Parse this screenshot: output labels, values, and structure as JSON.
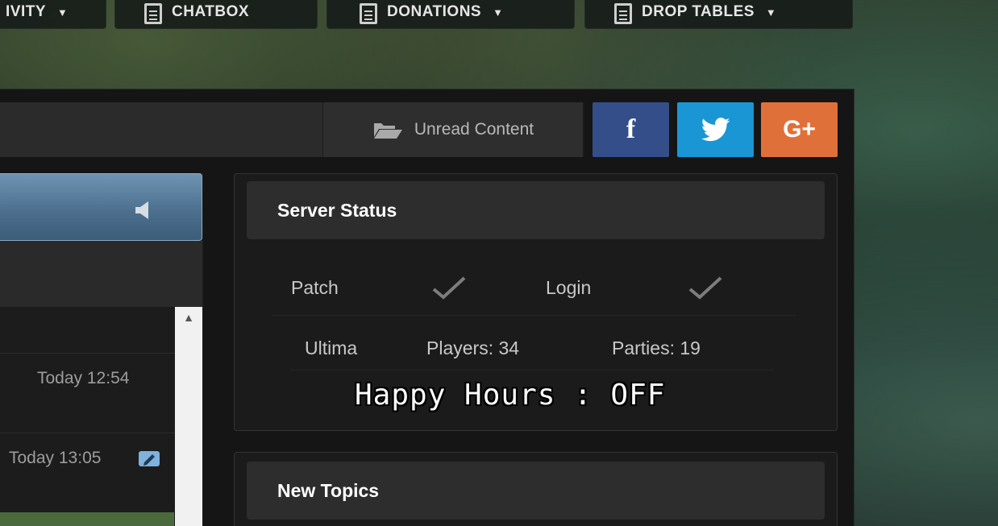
{
  "nav": {
    "items": [
      {
        "label": "IVITY",
        "icon": "caret-down-icon"
      },
      {
        "label": "CHATBOX",
        "icon": "document-icon"
      },
      {
        "label": "DONATIONS",
        "icon": "document-icon"
      },
      {
        "label": "DROP TABLES",
        "icon": "document-icon"
      }
    ]
  },
  "toolbar": {
    "unread_label": "Unread Content",
    "unread_icon": "folder-open-icon"
  },
  "social": {
    "facebook": "f",
    "google_plus": "G+",
    "colors": {
      "facebook": "#344e8a",
      "twitter": "#1a96d4",
      "google_plus": "#e0703a"
    }
  },
  "shoutbox": {
    "icon": "speaker-icon",
    "entries": [
      {
        "time": "Today 12:54"
      },
      {
        "time": "Today 13:05",
        "edited": true
      }
    ]
  },
  "server_status": {
    "title": "Server Status",
    "checks": [
      {
        "label": "Patch",
        "ok": true
      },
      {
        "label": "Login",
        "ok": true
      }
    ],
    "server_name": "Ultima",
    "players": "Players: 34",
    "parties": "Parties: 19",
    "happy_hours": "Happy Hours : OFF"
  },
  "new_topics": {
    "title": "New Topics"
  }
}
